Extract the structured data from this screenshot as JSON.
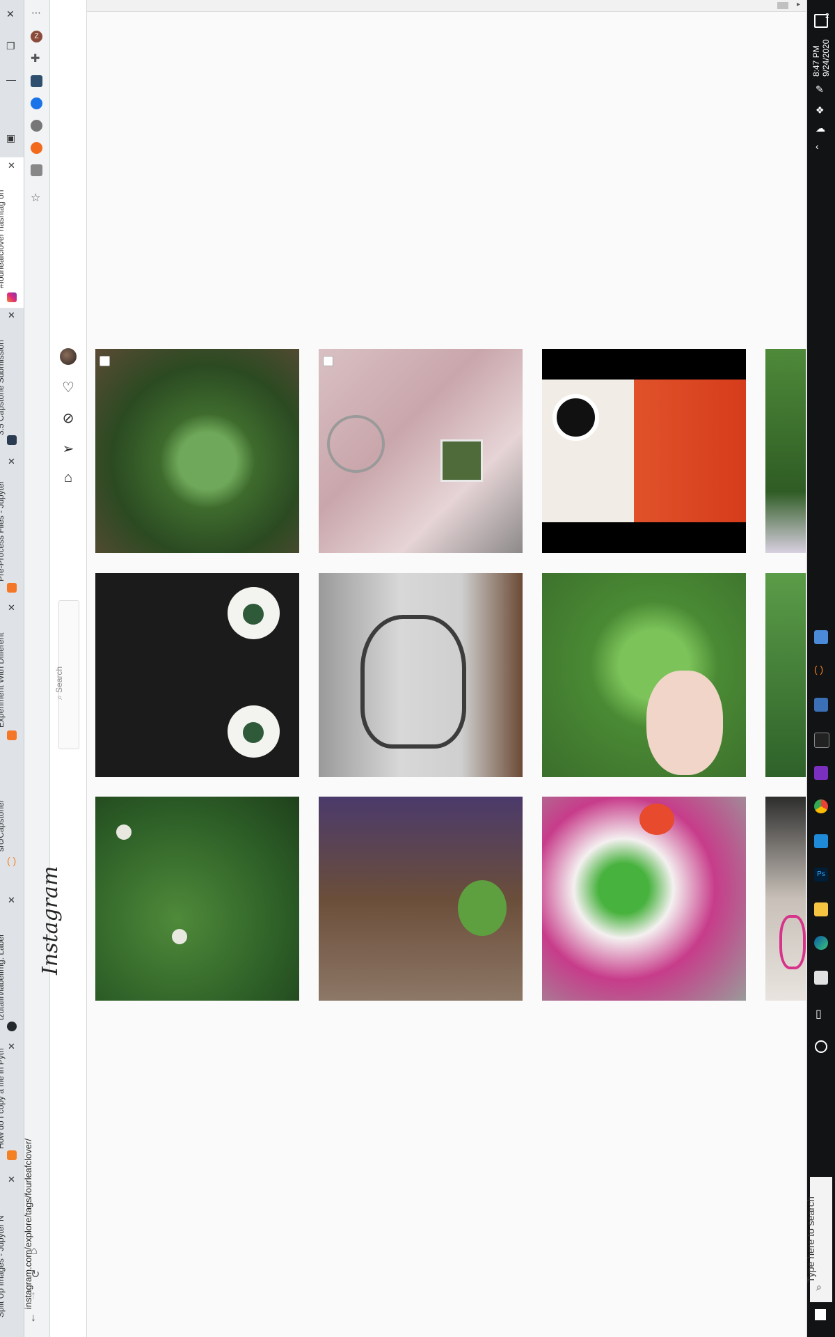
{
  "browser": {
    "tabs": [
      {
        "label": "Split Up Images - Jupyter N",
        "favicon_color": "#f37726"
      },
      {
        "label": "How do I copy a file in Pyth",
        "favicon_color": "#f48024"
      },
      {
        "label": "tzutalin/labelImg: Label",
        "favicon_color": "#24292e"
      },
      {
        "label": "src/Capstone/",
        "favicon_color": "#f48024"
      },
      {
        "label": "Experiment With Different",
        "favicon_color": "#f37726"
      },
      {
        "label": "Pre-Process Files - Jupyter",
        "favicon_color": "#f37726"
      },
      {
        "label": "3.5 Capstone Submission",
        "favicon_color": "#2b3b52"
      },
      {
        "label": "#fourleafclover hashtag on",
        "favicon_color": "#e1306c"
      }
    ],
    "url": "instagram.com/explore/tags/fourleafclover/",
    "extension_icons": [
      "profile-avatar-icon",
      "puzzle-icon",
      "extension-icon-1",
      "extension-icon-2",
      "extension-icon-3",
      "extension-icon-4",
      "extension-icon-5",
      "star-icon"
    ],
    "nav_icons": [
      "back-arrow-icon",
      "forward-arrow-icon",
      "reload-icon",
      "home-icon"
    ]
  },
  "instagram": {
    "logo": "Instagram",
    "search_placeholder": "Search",
    "nav_icons": [
      "home-icon",
      "direct-icon",
      "explore-icon",
      "activity-heart-icon",
      "profile-avatar"
    ]
  },
  "grid": {
    "posts": [
      {
        "desc": "four-leaf clover in grass"
      },
      {
        "desc": "keychain with clover"
      },
      {
        "desc": "coffee and flowers"
      },
      {
        "desc": "clover partial"
      },
      {
        "desc": "clover earrings"
      },
      {
        "desc": "pencil drawing"
      },
      {
        "desc": "hand holding clover"
      },
      {
        "desc": "clover partial 2"
      },
      {
        "desc": "clover patch"
      },
      {
        "desc": "clover in front of house"
      },
      {
        "desc": "coloring page flowers"
      },
      {
        "desc": "person partial"
      }
    ]
  },
  "taskbar": {
    "time": "8:47 PM",
    "date": "9/24/2020",
    "search_placeholder": "Type here to search",
    "notification_count": "2"
  }
}
